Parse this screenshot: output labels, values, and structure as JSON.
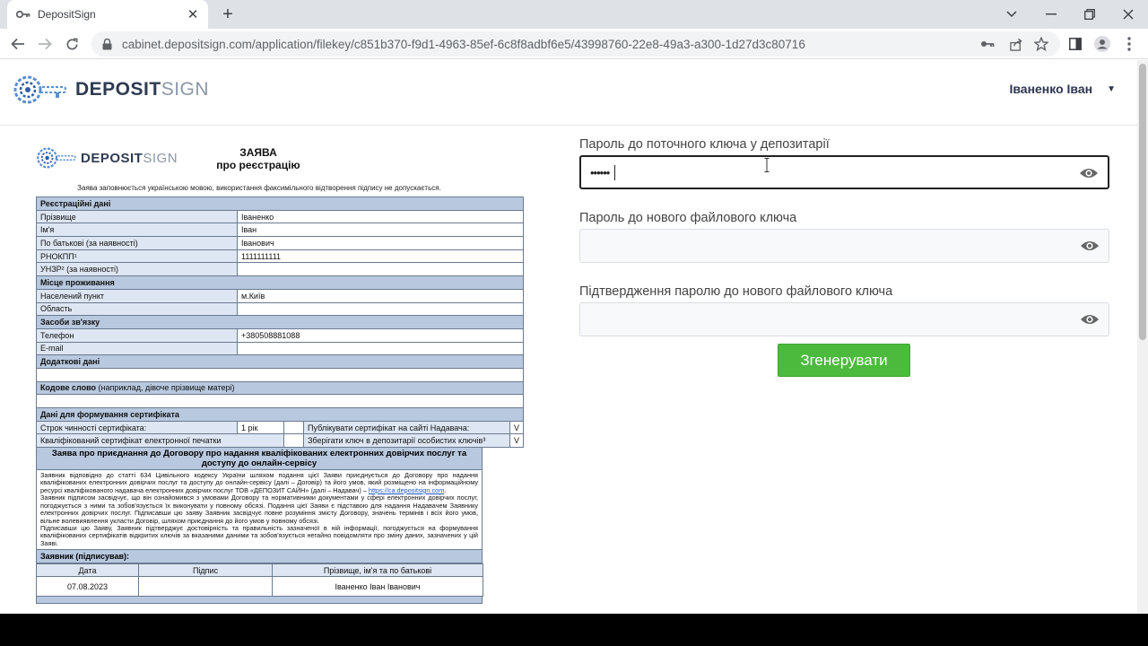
{
  "browser": {
    "tab_title": "DepositSign",
    "new_tab_symbol": "+",
    "url": "cabinet.depositsign.com/application/filekey/c851b370-f9d1-4963-85ef-6c8f8adbf6e5/43998760-22e8-49a3-a300-1d27d3c80716"
  },
  "header": {
    "logo_bold": "DEPOSIT",
    "logo_light": "SIGN",
    "user_name": "Іваненко Іван"
  },
  "doc": {
    "logo_bold": "DEPOSIT",
    "logo_light": "SIGN",
    "title_line1": "ЗАЯВА",
    "title_line2": "про реєстрацію",
    "note": "Заява заповнюється українською мовою, використання факсимільного відтворення підпису не допускається.",
    "sec_registration": "Реєстраційні дані",
    "surname_label": "Прізвище",
    "surname_value": "Іваненко",
    "name_label": "Ім'я",
    "name_value": "Іван",
    "patronymic_label": "По батькові (за наявності)",
    "patronymic_value": "Іванович",
    "rnokpp_label": "РНОКПП¹",
    "rnokpp_value": "1111111111",
    "unzr_label": "УНЗР² (за наявності)",
    "sec_residence": "Місце проживання",
    "city_label": "Населений пункт",
    "city_value": "м.Київ",
    "region_label": "Область",
    "sec_contacts": "Засоби зв'язку",
    "phone_label": "Телефон",
    "phone_value": "+380508881088",
    "email_label": "E-mail",
    "sec_additional": "Додаткові дані",
    "sec_codeword_bold": "Кодове слово",
    "sec_codeword_rest": " (наприклад, дівоче прізвище матері)",
    "sec_cert": "Дані для формування сертифіката",
    "validity_label": "Строк чинності сертифіката:",
    "validity_value": "1 рік",
    "publish_label": "Публікувати сертифікат на сайті Надавача:",
    "publish_value": "V",
    "seal_label": "Кваліфікований сертифікат електронної печатки",
    "store_label": "Зберігати ключ в депозитарії особистих ключів³",
    "store_value": "V",
    "decl_title": "Заява про приєднання до Договору про надання кваліфікованих електронних довірчих послуг та доступу до онлайн-сервісу",
    "decl_p1": "Заявник відповідно до статті 634 Цивільного кодексу України шляхом подання цієї Заяви приєднується до Договору про надання кваліфікованих електронних довірчих послуг та доступу до онлайн-сервісу (далі – Договір) та його умов, який розміщено на інформаційному ресурсі кваліфікованого надавача електронних довірчих послуг ТОВ «ДЕПОЗИТ САЙН» (далі – Надавач) –",
    "decl_link": "https://ca.depositsign.com",
    "decl_p2": "Заявник підписом засвідчує, що він ознайомився з умовами Договору та нормативними документами у сфері електронних довірчих послуг, погоджується з ними та зобов'язується їх виконувати у повному обсязі. Подання цієї Заяви є підставою для надання Надавачем Заявнику електронних довірчих послуг. Підписавши цю заяву Заявник засвідчує повне розуміння змісту Договору, значень термінів і всіх його умов, вільне волевиявлення укласти Договір, шляхом приєднання до його умов у повному обсязі.",
    "decl_p3": "Підписавши цю Заяву, Заявник підтверджує достовірність та правильність зазначеної в ній інформації, погоджується на формування кваліфікованих сертифікатів відкритих ключів за вказаними даними та зобов'язується негайно повідомляти про зміну даних, зазначених у цій Заяві.",
    "signer_title": "Заявник (підписував):",
    "col_date": "Дата",
    "col_signature": "Підпис",
    "col_fullname": "Прізвище, ім'я та по батькові",
    "date_value": "07.08.2023",
    "fullname_value": "Іваненко Іван Іванович"
  },
  "form": {
    "current_key_label": "Пароль до поточного ключа у депозитарії",
    "current_key_value": "••••••",
    "new_key_label": "Пароль до нового файлового ключа",
    "confirm_label": "Підтвердження паролю до нового файлового ключа",
    "generate_button": "Згенерувати"
  },
  "colors": {
    "accent_green": "#4cbb3d",
    "table_header_blue": "#b8c8de",
    "table_label_blue": "#dde6f2"
  }
}
